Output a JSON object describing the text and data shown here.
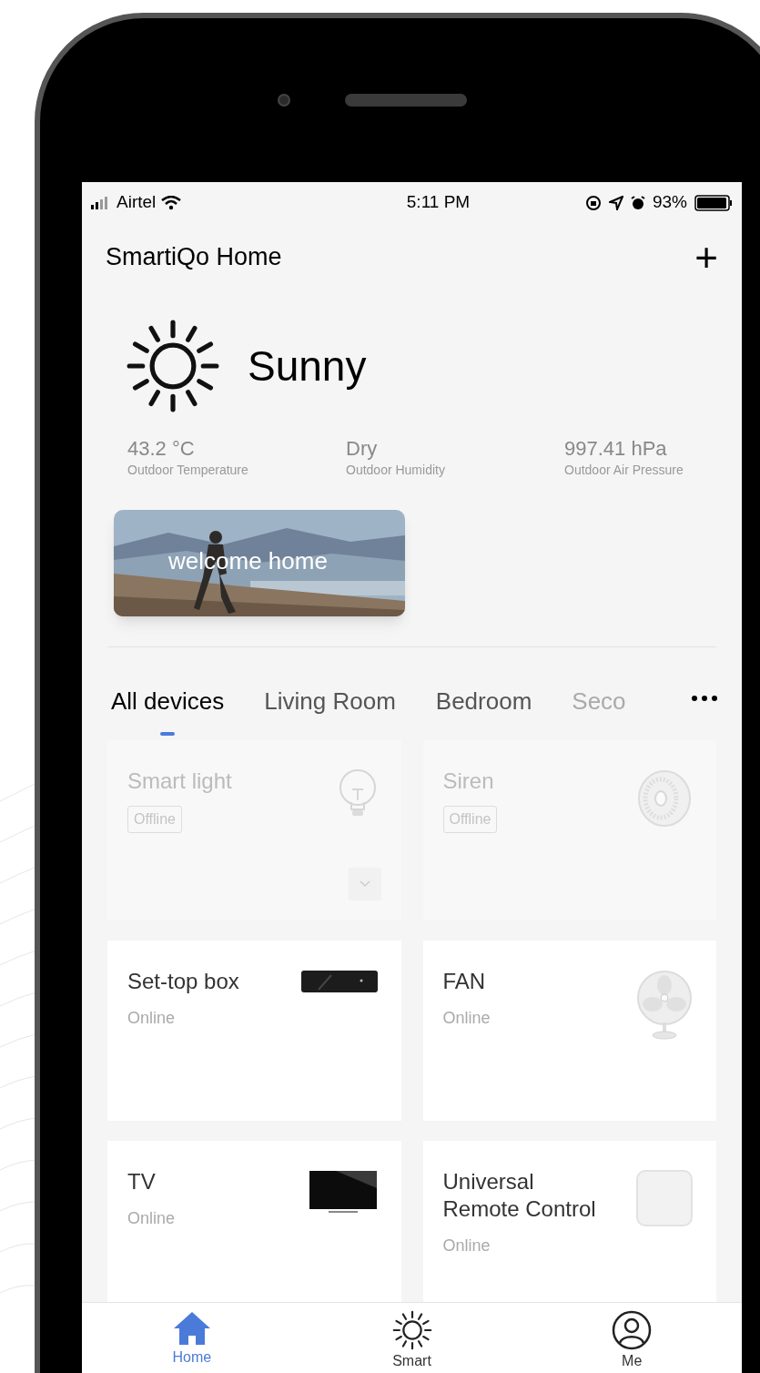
{
  "status_bar": {
    "carrier": "Airtel",
    "time": "5:11 PM",
    "battery": "93%"
  },
  "header": {
    "title": "SmartiQo Home",
    "add": "+"
  },
  "weather": {
    "condition": "Sunny",
    "stats": [
      {
        "value": "43.2 °C",
        "label": "Outdoor Temperature"
      },
      {
        "value": "Dry",
        "label": "Outdoor Humidity"
      },
      {
        "value": "997.41 hPa",
        "label": "Outdoor Air Pressure"
      }
    ]
  },
  "banner": {
    "text": "welcome home"
  },
  "tabs": [
    {
      "label": "All devices",
      "selected": true
    },
    {
      "label": "Living Room",
      "selected": false
    },
    {
      "label": "Bedroom",
      "selected": false
    },
    {
      "label": "Seco",
      "selected": false
    }
  ],
  "devices": [
    {
      "name": "Smart light",
      "status": "Offline",
      "online": false,
      "kind": "bulb",
      "expandable": true
    },
    {
      "name": "Siren",
      "status": "Offline",
      "online": false,
      "kind": "siren",
      "expandable": false
    },
    {
      "name": "Set-top box",
      "status": "Online",
      "online": true,
      "kind": "settop",
      "expandable": false
    },
    {
      "name": "FAN",
      "status": "Online",
      "online": true,
      "kind": "fan",
      "expandable": false
    },
    {
      "name": "TV",
      "status": "Online",
      "online": true,
      "kind": "tv",
      "expandable": false
    },
    {
      "name": "Universal Remote Control",
      "status": "Online",
      "online": true,
      "kind": "remote",
      "expandable": false
    }
  ],
  "nav": [
    {
      "label": "Home",
      "kind": "home",
      "selected": true
    },
    {
      "label": "Smart",
      "kind": "smart",
      "selected": false
    },
    {
      "label": "Me",
      "kind": "me",
      "selected": false
    }
  ]
}
